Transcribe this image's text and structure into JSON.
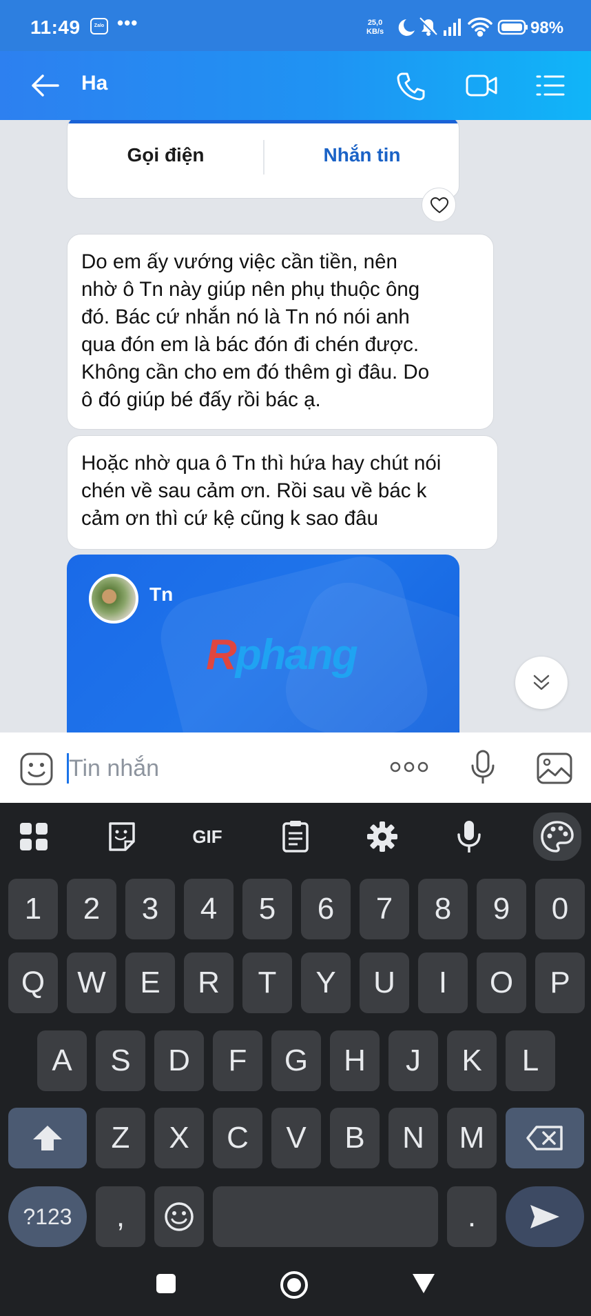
{
  "status_bar": {
    "time": "11:49",
    "app_badge": "Zalo",
    "more": "•••",
    "net_speed_value": "25,0",
    "net_speed_unit": "KB/s",
    "battery": "98%"
  },
  "header": {
    "title": "Ha",
    "icons": [
      "back-arrow-icon",
      "phone-icon",
      "video-call-icon",
      "menu-icon"
    ]
  },
  "contact_card": {
    "call_label": "Gọi điện",
    "message_label": "Nhắn tin"
  },
  "messages": [
    {
      "text": "Do em ấy vướng việc cần tiền, nên\nnhờ ô Tn này giúp nên phụ thuộc ông\nđó. Bác cứ nhắn nó là Tn nó nói anh\nqua đón em là bác đón đi chén được.\nKhông cần cho em đó thêm gì đâu. Do\nô đó giúp bé đấy rồi bác ạ."
    },
    {
      "text": "Hoặc nhờ qua ô Tn thì hứa hay chút nói\nchén về sau cảm ơn. Rồi sau về bác k\ncảm ơn thì cứ kệ cũng k sao đâu"
    }
  ],
  "profile_card": {
    "name": "Tn",
    "watermark_r": "R",
    "watermark_rest": "phang"
  },
  "input": {
    "placeholder": "Tin nhắn",
    "value": ""
  },
  "keyboard": {
    "toolbar": [
      "apps-grid-icon",
      "sticker-icon",
      "GIF",
      "clipboard-icon",
      "settings-gear-icon",
      "mic-icon",
      "palette-icon"
    ],
    "gif_label": "GIF",
    "row_numbers": [
      "1",
      "2",
      "3",
      "4",
      "5",
      "6",
      "7",
      "8",
      "9",
      "0"
    ],
    "row_top": [
      "Q",
      "W",
      "E",
      "R",
      "T",
      "Y",
      "U",
      "I",
      "O",
      "P"
    ],
    "row_home": [
      "A",
      "S",
      "D",
      "F",
      "G",
      "H",
      "J",
      "K",
      "L"
    ],
    "row_bottom": [
      "Z",
      "X",
      "C",
      "V",
      "B",
      "N",
      "M"
    ],
    "symbols_label": "?123",
    "comma": ",",
    "period": "."
  },
  "nav_bar": [
    "recents-icon",
    "home-icon",
    "back-icon"
  ],
  "colors": {
    "accent": "#1a62d6",
    "header_start": "#2d80f0",
    "header_end": "#10b5f8",
    "chat_bg": "#e2e5ea",
    "keyboard_bg": "#1f2124"
  }
}
